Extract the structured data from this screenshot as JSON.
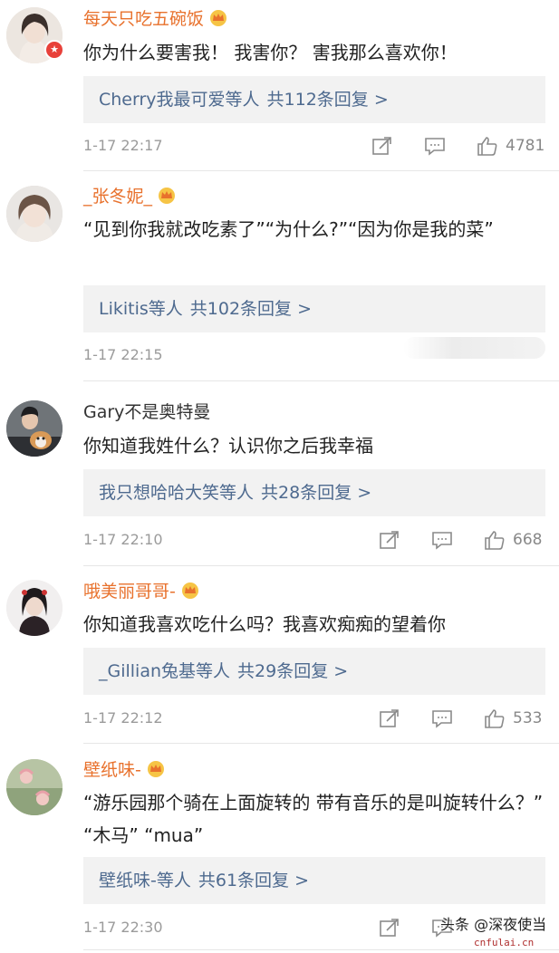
{
  "colors": {
    "vip_name": "#e8712c",
    "reply_link": "#4e6a8f",
    "meta_gray": "#9b9b9b",
    "reply_bg": "#f2f2f2"
  },
  "comments": [
    {
      "username": "每天只吃五碗饭",
      "vip": true,
      "text": "你为什么要害我！ 我害你？ 害我那么喜欢你！",
      "replies_users": "Cherry我最可爱等人",
      "replies_count": "共112条回复 >",
      "time": "1-17 22:17",
      "likes": "4781",
      "icons": [
        "repost-icon",
        "comment-icon",
        "like-icon"
      ]
    },
    {
      "username": "_张冬妮_",
      "vip": true,
      "text": "“见到你我就改吃素了”“为什么?”“因为你是我的菜”",
      "replies_users": "Likitis等人",
      "replies_count": "共102条回复 >",
      "time": "1-17 22:15",
      "likes": ""
    },
    {
      "username": "Gary不是奥特曼",
      "vip": false,
      "text": "你知道我姓什么？认识你之后我幸福",
      "replies_users": "我只想哈哈大笑等人",
      "replies_count": "共28条回复 >",
      "time": "1-17 22:10",
      "likes": "668"
    },
    {
      "username": "哦美丽哥哥-",
      "vip": true,
      "text": "你知道我喜欢吃什么吗？我喜欢痴痴的望着你",
      "replies_users": "_Gillian兔基等人",
      "replies_count": "共29条回复 >",
      "time": "1-17 22:12",
      "likes": "533"
    },
    {
      "username": "壁纸味-",
      "vip": true,
      "text": "“游乐园那个骑在上面旋转的 带有音乐的是叫旋转什么？” “木马” “mua”",
      "replies_users": "壁纸味-等人",
      "replies_count": "共61条回复 >",
      "time": "1-17 22:30",
      "likes": ""
    }
  ],
  "watermark": {
    "text": "头条 @深夜使当",
    "url": "cnfulai.cn"
  }
}
